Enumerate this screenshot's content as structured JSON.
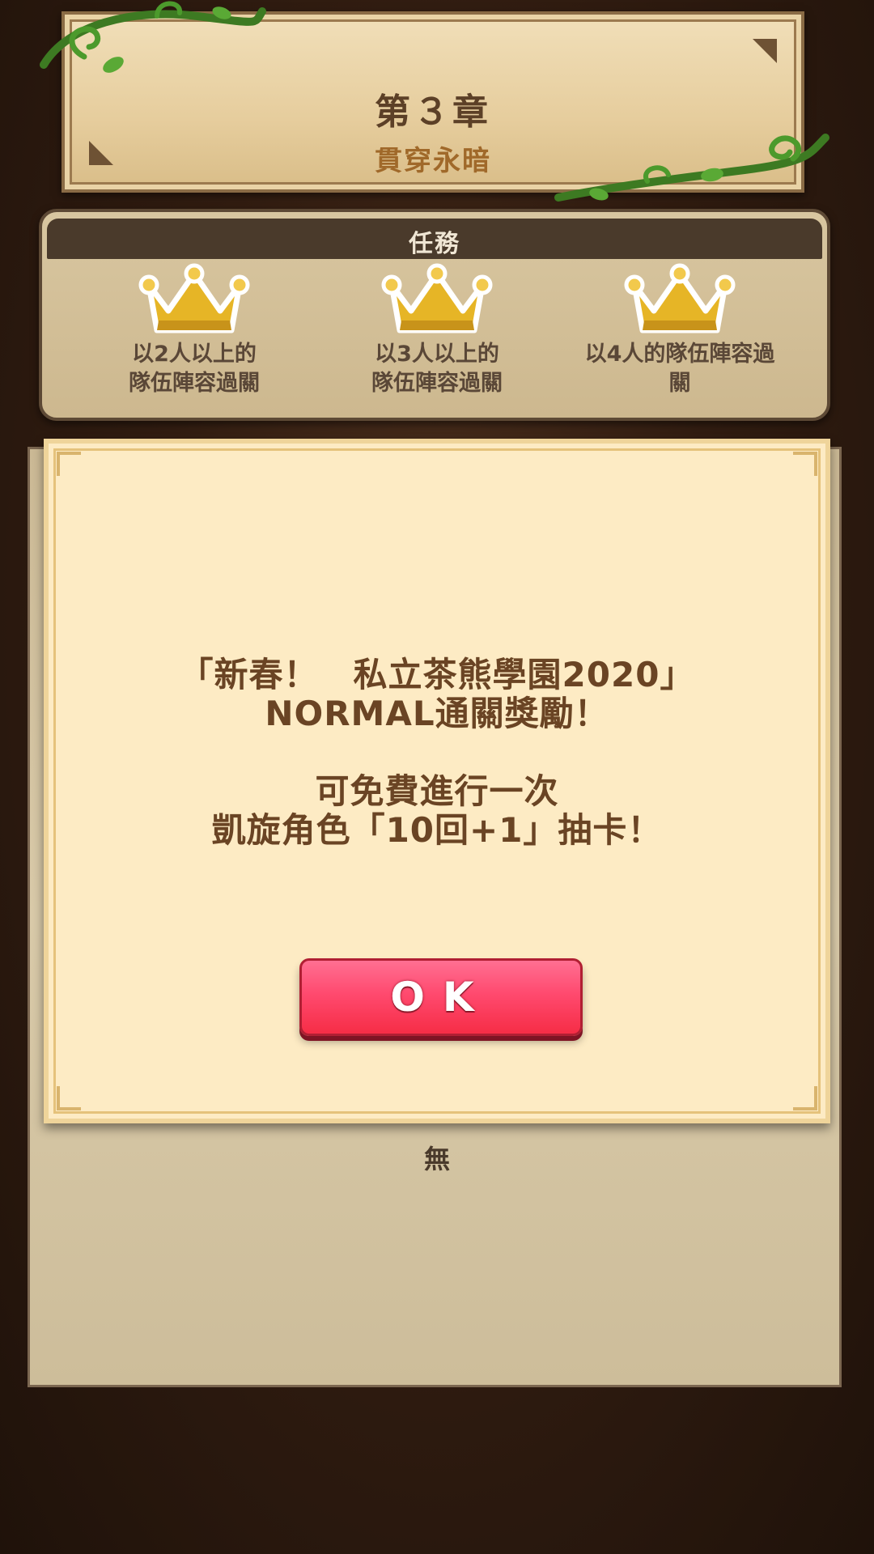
{
  "chapter": {
    "title": "第３章",
    "subtitle": "貫穿永暗"
  },
  "missions": {
    "header": "任務",
    "items": [
      {
        "line1": "以2人以上的",
        "line2": "隊伍陣容過關",
        "icon": "crown-icon"
      },
      {
        "line1": "以3人以上的",
        "line2": "隊伍陣容過關",
        "icon": "crown-icon"
      },
      {
        "line1": "以4人的隊伍陣容過",
        "line2": "關",
        "icon": "crown-icon"
      }
    ]
  },
  "rewards": {
    "empty_text": "無"
  },
  "dialog": {
    "line1": "「新春！　私立茶熊學園2020」",
    "line2": "NORMAL通關獎勵！",
    "line3": "可免費進行一次",
    "line4": "凱旋角色「10回+1」抽卡！",
    "ok_label": "OK"
  },
  "colors": {
    "ok_button": "#ff4a6f",
    "dialog_bg": "#fdebc4",
    "text_brown": "#6a4424",
    "crown_gold": "#e6b526"
  }
}
